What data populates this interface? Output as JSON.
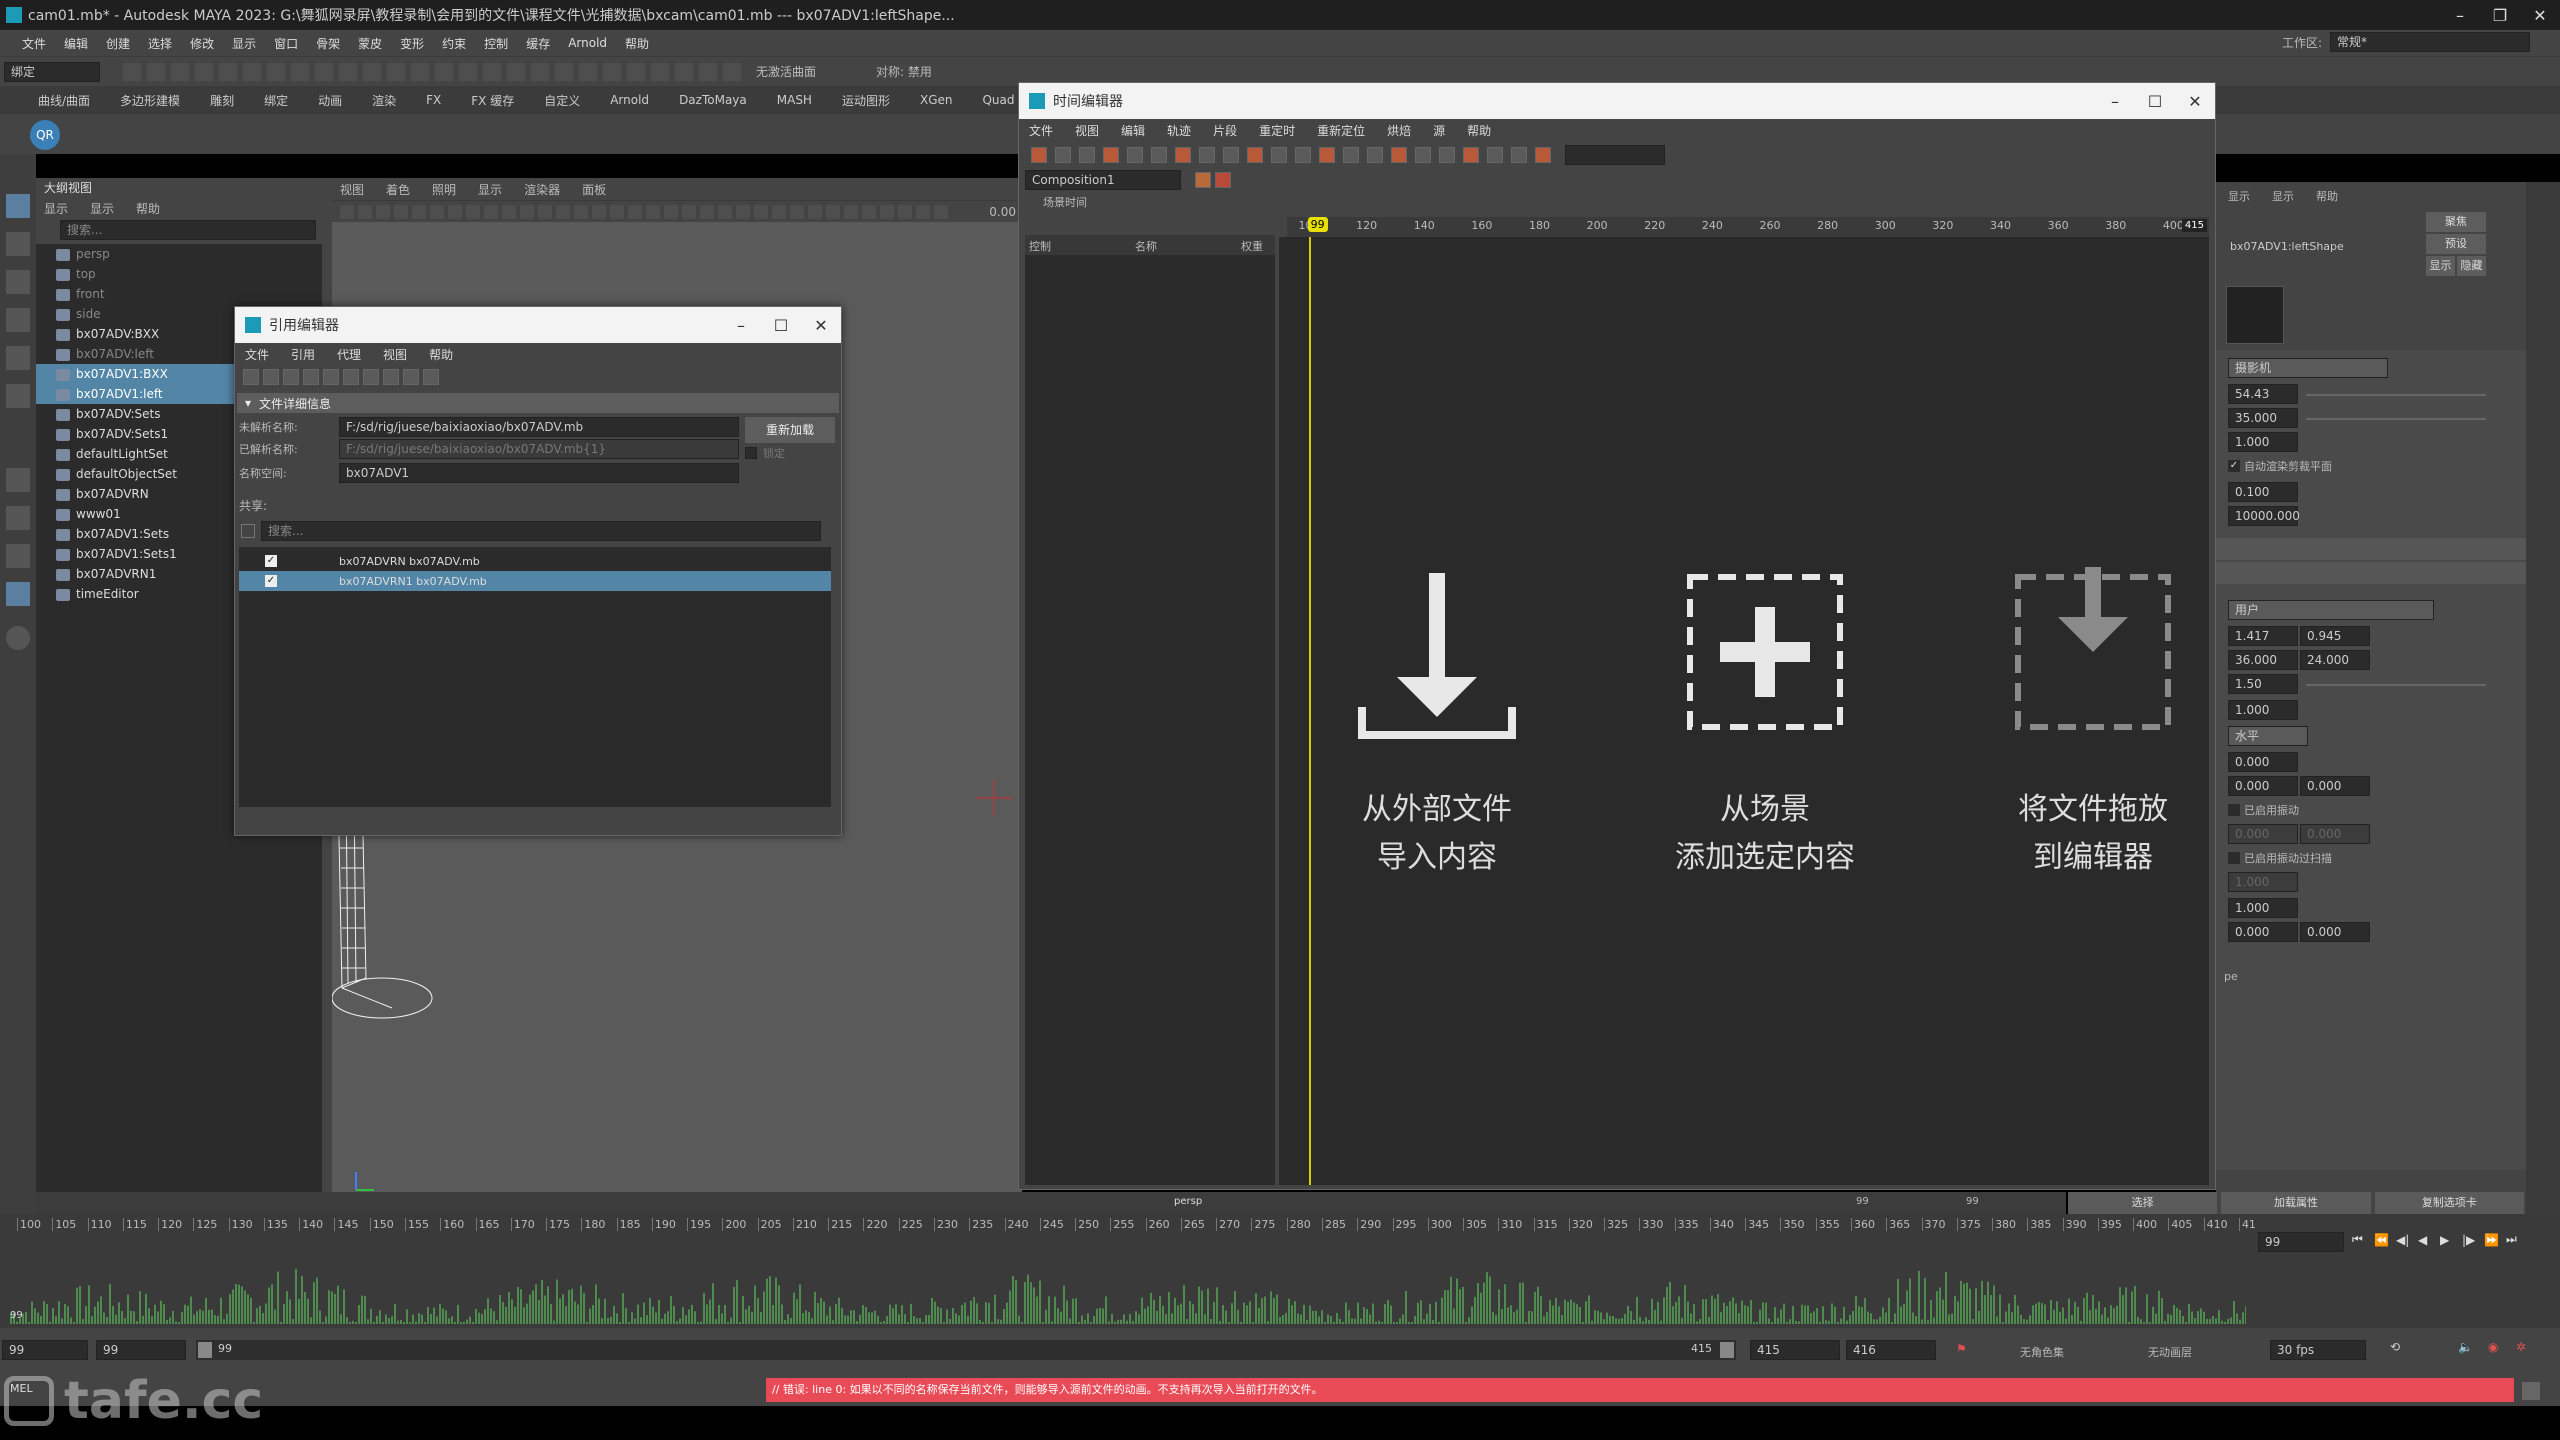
{
  "app": {
    "title": "cam01.mb* - Autodesk MAYA 2023: G:\\舞狐网录屏\\教程录制\\会用到的文件\\课程文件\\光捕数据\\bxcam\\cam01.mb   ---   bx07ADV1:leftShape...",
    "workspace_label": "工作区:",
    "workspace_value": "常规*"
  },
  "main_menu": [
    "文件",
    "编辑",
    "创建",
    "选择",
    "修改",
    "显示",
    "窗口",
    "骨架",
    "蒙皮",
    "变形",
    "约束",
    "控制",
    "缓存",
    "Arnold",
    "帮助"
  ],
  "status_line": {
    "mode": "绑定",
    "no_live": "无激活曲面",
    "symmetry": "对称: 禁用"
  },
  "shelf_tabs": [
    "曲线/曲面",
    "多边形建模",
    "雕刻",
    "绑定",
    "动画",
    "渲染",
    "FX",
    "FX 缓存",
    "自定义",
    "Arnold",
    "DazToMaya",
    "MASH",
    "运动图形",
    "XGen",
    "Quad"
  ],
  "outliner": {
    "title": "大纲视图",
    "menu": [
      "显示",
      "显示",
      "帮助"
    ],
    "search_placeholder": "搜索...",
    "items": [
      {
        "label": "persp",
        "dim": true,
        "hl": false
      },
      {
        "label": "top",
        "dim": true,
        "hl": false
      },
      {
        "label": "front",
        "dim": true,
        "hl": false
      },
      {
        "label": "side",
        "dim": true,
        "hl": false
      },
      {
        "label": "bx07ADV:BXX",
        "dim": false,
        "hl": false
      },
      {
        "label": "bx07ADV:left",
        "dim": true,
        "hl": false
      },
      {
        "label": "bx07ADV1:BXX",
        "dim": false,
        "hl": true
      },
      {
        "label": "bx07ADV1:left",
        "dim": false,
        "hl": true
      },
      {
        "label": "bx07ADV:Sets",
        "dim": false,
        "hl": false
      },
      {
        "label": "bx07ADV:Sets1",
        "dim": false,
        "hl": false
      },
      {
        "label": "defaultLightSet",
        "dim": false,
        "hl": false
      },
      {
        "label": "defaultObjectSet",
        "dim": false,
        "hl": false
      },
      {
        "label": "bx07ADVRN",
        "dim": false,
        "hl": false
      },
      {
        "label": "www01",
        "dim": false,
        "hl": false
      },
      {
        "label": "bx07ADV1:Sets",
        "dim": false,
        "hl": false
      },
      {
        "label": "bx07ADV1:Sets1",
        "dim": false,
        "hl": false
      },
      {
        "label": "bx07ADVRN1",
        "dim": false,
        "hl": false
      },
      {
        "label": "timeEditor",
        "dim": false,
        "hl": false
      }
    ]
  },
  "viewport": {
    "menu": [
      "视图",
      "着色",
      "照明",
      "显示",
      "渲染器",
      "面板"
    ],
    "value": "0.00",
    "camera_label": "persp"
  },
  "ref_editor": {
    "title": "引用编辑器",
    "menu": [
      "文件",
      "引用",
      "代理",
      "视图",
      "帮助"
    ],
    "section": "文件详细信息",
    "unresolved_label": "未解析名称:",
    "unresolved_value": "F:/sd/rig/juese/baixiaoxiao/bx07ADV.mb",
    "resolved_label": "已解析名称:",
    "resolved_value": "F:/sd/rig/juese/baixiaoxiao/bx07ADV.mb{1}",
    "namespace_label": "名称空间:",
    "namespace_value": "bx07ADV1",
    "shared_label": "共享:",
    "reload_btn": "重新加载",
    "lock_label": "锁定",
    "search_placeholder": "搜索...",
    "rows": [
      {
        "label": "bx07ADVRN  bx07ADV.mb",
        "selected": false
      },
      {
        "label": "bx07ADVRN1  bx07ADV.mb",
        "selected": true
      }
    ]
  },
  "time_editor": {
    "title": "时间编辑器",
    "menu": [
      "文件",
      "视图",
      "编辑",
      "轨迹",
      "片段",
      "重定时",
      "重新定位",
      "烘焙",
      "源",
      "帮助"
    ],
    "composition": "Composition1",
    "scene_time": "场景时间",
    "col_control": "控制",
    "col_name": "名称",
    "col_weight": "权重",
    "current_frame": "99",
    "end_frame": "415",
    "ruler_ticks": [
      "100",
      "120",
      "140",
      "160",
      "180",
      "200",
      "220",
      "240",
      "260",
      "280",
      "300",
      "320",
      "340",
      "360",
      "380",
      "400"
    ],
    "drop_zones": [
      {
        "line1": "从外部文件",
        "line2": "导入内容",
        "icon": "import-arrow-icon"
      },
      {
        "line1": "从场景",
        "line2": "添加选定内容",
        "icon": "add-plus-icon"
      },
      {
        "line1": "将文件拖放",
        "line2": "到编辑器",
        "icon": "drop-file-icon"
      }
    ]
  },
  "attr_editor": {
    "menu": [
      "显示",
      "显示",
      "帮助"
    ],
    "node": "bx07ADV1:leftShape",
    "btn_focus": "聚焦",
    "btn_preset": "预设",
    "btn_show": "显示",
    "btn_hide": "隐藏",
    "camera_dropdown": "摄影机",
    "fields": [
      "54.43",
      "35.000",
      "1.000"
    ],
    "auto_clip_label": "自动渲染剪裁平面",
    "clip_near": "0.100",
    "clip_far": "10000.000",
    "user_dropdown": "用户",
    "aperture_a": "1.417",
    "aperture_b": "0.945",
    "aperture_mm_a": "36.000",
    "aperture_mm_b": "24.000",
    "ratio": "1.50",
    "one": "1.000",
    "fit_dropdown": "水平",
    "offset_a": "0.000",
    "offset_b": "0.000",
    "offset_c": "0.000",
    "shake_label": "已启用振动",
    "shake_a": "0.000",
    "shake_b": "0.000",
    "overscan_label": "已启用振动过扫描",
    "overscan_val": "1.000",
    "last_one": "1.000",
    "last_a": "0.000",
    "last_b": "0.000",
    "pe_label": "pe",
    "bottom_btns": [
      "选择",
      "加载属性",
      "复制选项卡"
    ]
  },
  "panel_status": {
    "left": "99",
    "right": "99"
  },
  "timeline": {
    "ticks": [
      "100",
      "105",
      "110",
      "115",
      "120",
      "125",
      "130",
      "135",
      "140",
      "145",
      "150",
      "155",
      "160",
      "165",
      "170",
      "175",
      "180",
      "185",
      "190",
      "195",
      "200",
      "205",
      "210",
      "215",
      "220",
      "225",
      "230",
      "235",
      "240",
      "245",
      "250",
      "255",
      "260",
      "265",
      "270",
      "275",
      "280",
      "285",
      "290",
      "295",
      "300",
      "305",
      "310",
      "315",
      "320",
      "325",
      "330",
      "335",
      "340",
      "345",
      "350",
      "355",
      "360",
      "365",
      "370",
      "375",
      "380",
      "385",
      "390",
      "395",
      "400",
      "405",
      "410",
      "41"
    ],
    "current": "99",
    "frame_field": "99"
  },
  "range_bar": {
    "start": "99",
    "start2": "99",
    "slider_start": "99",
    "slider_end": "415",
    "end": "415",
    "end2": "416",
    "char_set": "无角色集",
    "anim_layer": "无动画层",
    "fps": "30 fps"
  },
  "command_line": {
    "label": "MEL",
    "message": "// 错误: line 0: 如果以不同的名称保存当前文件，则能够导入源前文件的动画。不支持再次导入当前打开的文件。"
  },
  "watermark": "tafe.cc"
}
